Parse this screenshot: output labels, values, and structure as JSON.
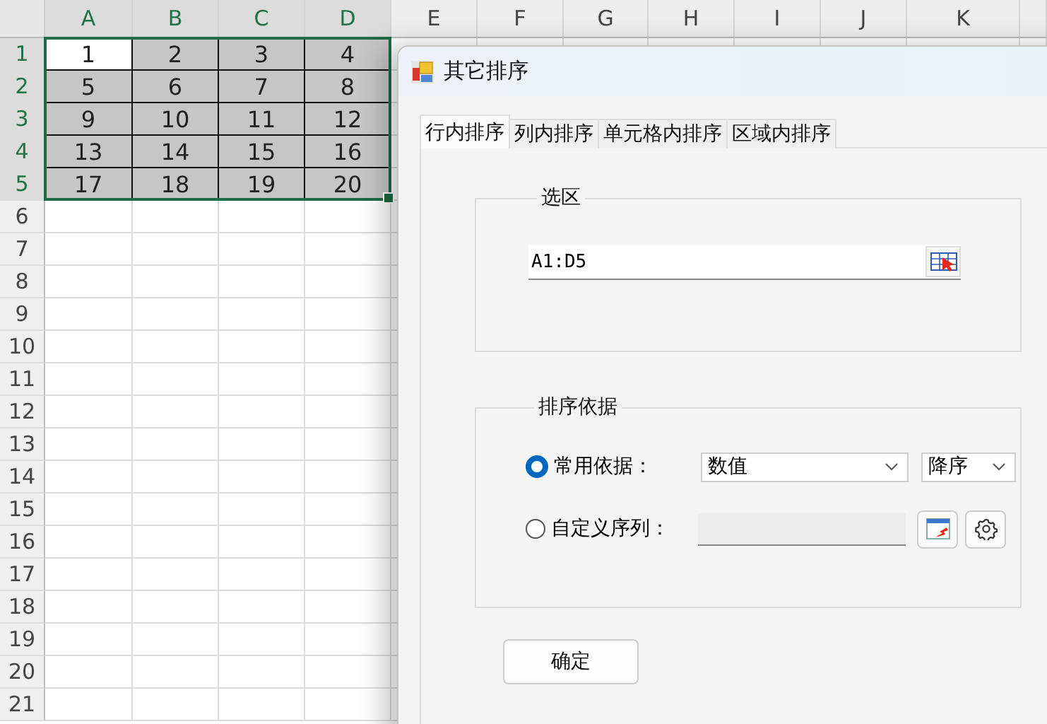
{
  "sheet": {
    "columns": [
      "A",
      "B",
      "C",
      "D",
      "E",
      "F",
      "G",
      "H",
      "I",
      "J",
      "K"
    ],
    "rows": [
      {
        "header": "1",
        "cells": [
          {
            "value": "1",
            "active": true
          },
          {
            "value": "2",
            "active": false
          },
          {
            "value": "3",
            "active": false
          },
          {
            "value": "4",
            "active": false
          }
        ]
      },
      {
        "header": "2",
        "cells": [
          {
            "value": "5",
            "active": false
          },
          {
            "value": "6",
            "active": false
          },
          {
            "value": "7",
            "active": false
          },
          {
            "value": "8",
            "active": false
          }
        ]
      },
      {
        "header": "3",
        "cells": [
          {
            "value": "9",
            "active": false
          },
          {
            "value": "10",
            "active": false
          },
          {
            "value": "11",
            "active": false
          },
          {
            "value": "12",
            "active": false
          }
        ]
      },
      {
        "header": "4",
        "cells": [
          {
            "value": "13",
            "active": false
          },
          {
            "value": "14",
            "active": false
          },
          {
            "value": "15",
            "active": false
          },
          {
            "value": "16",
            "active": false
          }
        ]
      },
      {
        "header": "5",
        "cells": [
          {
            "value": "17",
            "active": false
          },
          {
            "value": "18",
            "active": false
          },
          {
            "value": "19",
            "active": false
          },
          {
            "value": "20",
            "active": false
          }
        ]
      },
      {
        "header": "6"
      },
      {
        "header": "7"
      },
      {
        "header": "8"
      },
      {
        "header": "9"
      },
      {
        "header": "10"
      },
      {
        "header": "11"
      },
      {
        "header": "12"
      },
      {
        "header": "13"
      },
      {
        "header": "14"
      },
      {
        "header": "15"
      },
      {
        "header": "16"
      },
      {
        "header": "17"
      },
      {
        "header": "18"
      },
      {
        "header": "19"
      },
      {
        "header": "20"
      },
      {
        "header": "21"
      }
    ]
  },
  "dialog": {
    "title": "其它排序",
    "tabs": [
      {
        "label": "行内排序",
        "selected": true
      },
      {
        "label": "列内排序",
        "selected": false
      },
      {
        "label": "单元格内排序",
        "selected": false
      },
      {
        "label": "区域内排序",
        "selected": false
      }
    ],
    "selection_group": {
      "legend": "选区",
      "range": "A1:D5"
    },
    "sort_group": {
      "legend": "排序依据",
      "options": [
        {
          "kind": "dropdowns",
          "label": "常用依据：",
          "selected": true,
          "basis": "数值",
          "order": "降序"
        },
        {
          "kind": "custom",
          "label": "自定义序列：",
          "selected": false,
          "disabled": true
        }
      ]
    },
    "ok_button": "确定"
  }
}
